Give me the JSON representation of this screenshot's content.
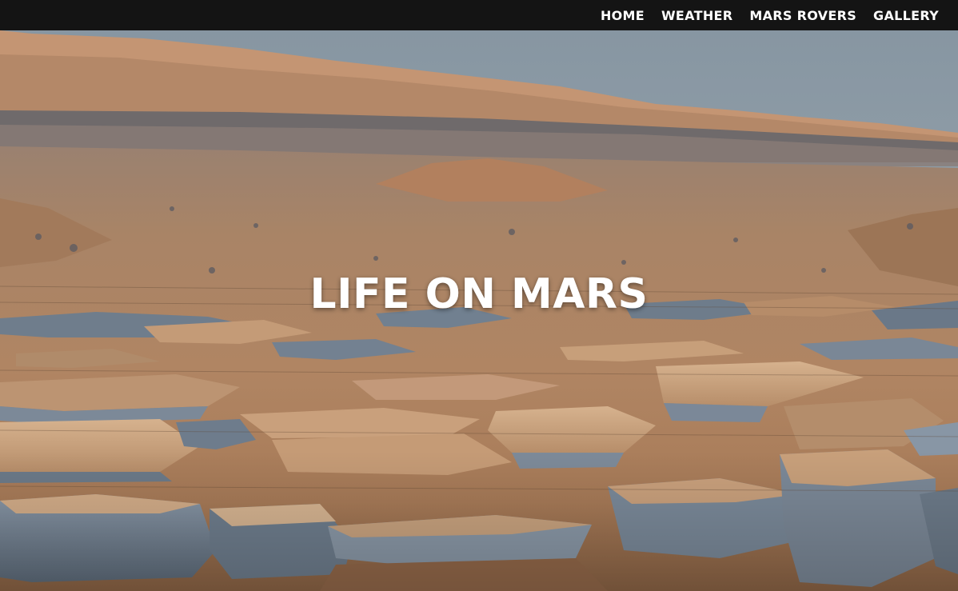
{
  "nav": {
    "items": [
      {
        "label": "HOME"
      },
      {
        "label": "WEATHER"
      },
      {
        "label": "MARS ROVERS"
      },
      {
        "label": "GALLERY"
      }
    ]
  },
  "hero": {
    "title": "LIFE ON MARS",
    "image": "mars-rocky-landscape-photo"
  },
  "colors": {
    "navbar_bg": "#141414",
    "text": "#ffffff",
    "sky": "#8a9aa6",
    "terrain": "#a87f5c",
    "rock_light": "#c9a27c",
    "rock_shadow": "#6f7e8e"
  }
}
